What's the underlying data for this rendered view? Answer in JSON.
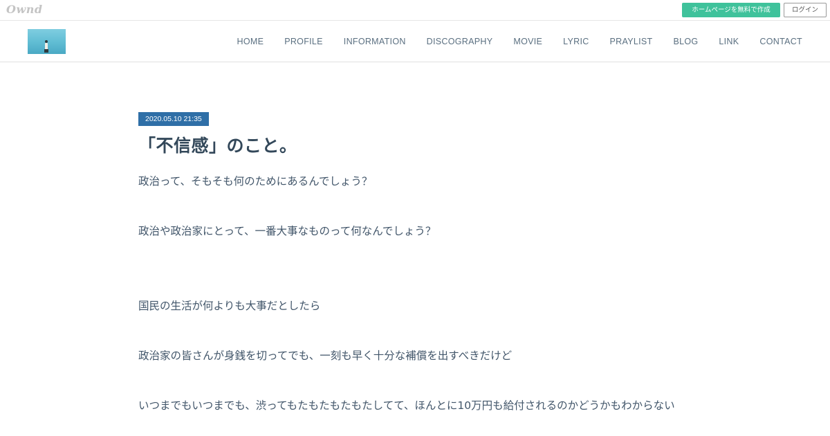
{
  "topbar": {
    "logo": "Ownd",
    "create_label": "ホームページを無料で作成",
    "login_label": "ログイン"
  },
  "nav": {
    "items": [
      "HOME",
      "PROFILE",
      "INFORMATION",
      "DISCOGRAPHY",
      "MOVIE",
      "LYRIC",
      "PRAYLIST",
      "BLOG",
      "LINK",
      "CONTACT"
    ]
  },
  "article": {
    "date": "2020.05.10 21:35",
    "title": "「不信感」のこと。",
    "paragraphs": [
      "政治って、そもそも何のためにあるんでしょう？",
      "政治や政治家にとって、一番大事なものって何なんでしょう？",
      "国民の生活が何よりも大事だとしたら",
      "政治家の皆さんが身銭を切ってでも、一刻も早く十分な補償を出すべきだけど",
      "いつまでもいつまでも、渋ってもたもたもたもたしてて、ほんとに10万円も給付されるのかどうかもわからない"
    ]
  },
  "colors": {
    "accent_green": "#3fc29b",
    "date_badge": "#2f6fa7",
    "text": "#42566a"
  }
}
